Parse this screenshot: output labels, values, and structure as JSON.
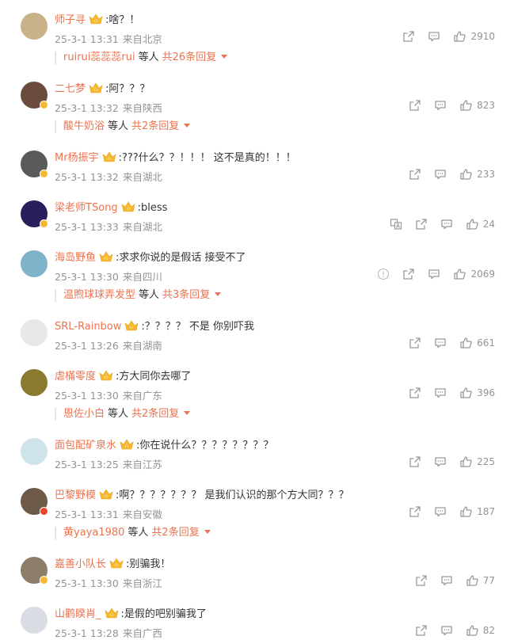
{
  "comments": [
    {
      "name": "师子寻",
      "text": ":啥？！",
      "date": "25-3-1 13:31",
      "loc": "来自北京",
      "likes": "2910",
      "badge": "none",
      "avatar_color": "#c9b28a",
      "reply": {
        "who": "ruirui蕊蕊蕊rui",
        "etc": "等人",
        "more": "共26条回复"
      }
    },
    {
      "name": "二七梦",
      "text": ":阿？？？",
      "date": "25-3-1 13:32",
      "loc": "来自陕西",
      "likes": "823",
      "badge": "yellow",
      "avatar_color": "#6b4b3e",
      "reply": {
        "who": "酸牛奶浴",
        "etc": "等人",
        "more": "共2条回复"
      }
    },
    {
      "name": "Mr杨振宇",
      "text": ":???什么？？！！！ 这不是真的！！！",
      "date": "25-3-1 13:32",
      "loc": "来自湖北",
      "likes": "233",
      "badge": "yellow",
      "avatar_color": "#5a5a5a",
      "reply": null
    },
    {
      "name": "梁老师TSong",
      "text": ":bless",
      "date": "25-3-1 13:33",
      "loc": "来自湖北",
      "likes": "24",
      "badge": "yellow",
      "avatar_color": "#2a1f5c",
      "reply": null,
      "translate": true
    },
    {
      "name": "海岛野鱼",
      "text": ":求求你说的是假话 接受不了",
      "date": "25-3-1 13:30",
      "loc": "来自四川",
      "likes": "2069",
      "badge": "none",
      "avatar_color": "#7fb3c9",
      "reply": {
        "who": "温煦球球弄发型",
        "etc": "等人",
        "more": "共3条回复"
      },
      "info": true
    },
    {
      "name": "SRL-Rainbow",
      "text": ":？？？？ 不是 你别吓我",
      "date": "25-3-1 13:26",
      "loc": "来自湖南",
      "likes": "661",
      "badge": "none",
      "avatar_color": "#e8e8e8",
      "reply": null
    },
    {
      "name": "虐樠零度",
      "text": ":方大同你去哪了",
      "date": "25-3-1 13:30",
      "loc": "来自广东",
      "likes": "396",
      "badge": "none",
      "avatar_color": "#8a7a30",
      "reply": {
        "who": "恩佐小白",
        "etc": "等人",
        "more": "共2条回复"
      }
    },
    {
      "name": "面包配矿泉水",
      "text": ":你在说什么？？？？？？？？",
      "date": "25-3-1 13:25",
      "loc": "来自江苏",
      "likes": "225",
      "badge": "none",
      "avatar_color": "#cfe3ea",
      "reply": null
    },
    {
      "name": "巴黎野模",
      "text": ":啊？？？？？？？ 是我们认识的那个方大同？？？",
      "date": "25-3-1 13:31",
      "loc": "来自安徽",
      "likes": "187",
      "badge": "red",
      "avatar_color": "#6d5a48",
      "reply": {
        "who": "黄yaya1980",
        "etc": "等人",
        "more": "共2条回复"
      }
    },
    {
      "name": "嘉善小队长",
      "text": ":别骗我！",
      "date": "25-3-1 13:30",
      "loc": "来自浙江",
      "likes": "77",
      "badge": "yellow",
      "avatar_color": "#8c7e6a",
      "reply": null
    },
    {
      "name": "山鹳睽肖_",
      "text": ":是假的吧别骗我了",
      "date": "25-3-1 13:28",
      "loc": "来自广西",
      "likes": "82",
      "badge": "none",
      "avatar_color": "#d9dde3",
      "reply": null
    }
  ],
  "colors": {
    "accent": "#eb7350",
    "meta": "#939393",
    "crown": "#f6b830"
  },
  "icons": {
    "share": "share-icon",
    "comment": "comment-icon",
    "like": "like-icon",
    "translate": "translate-icon",
    "info": "info-icon",
    "crown": "crown-icon"
  }
}
